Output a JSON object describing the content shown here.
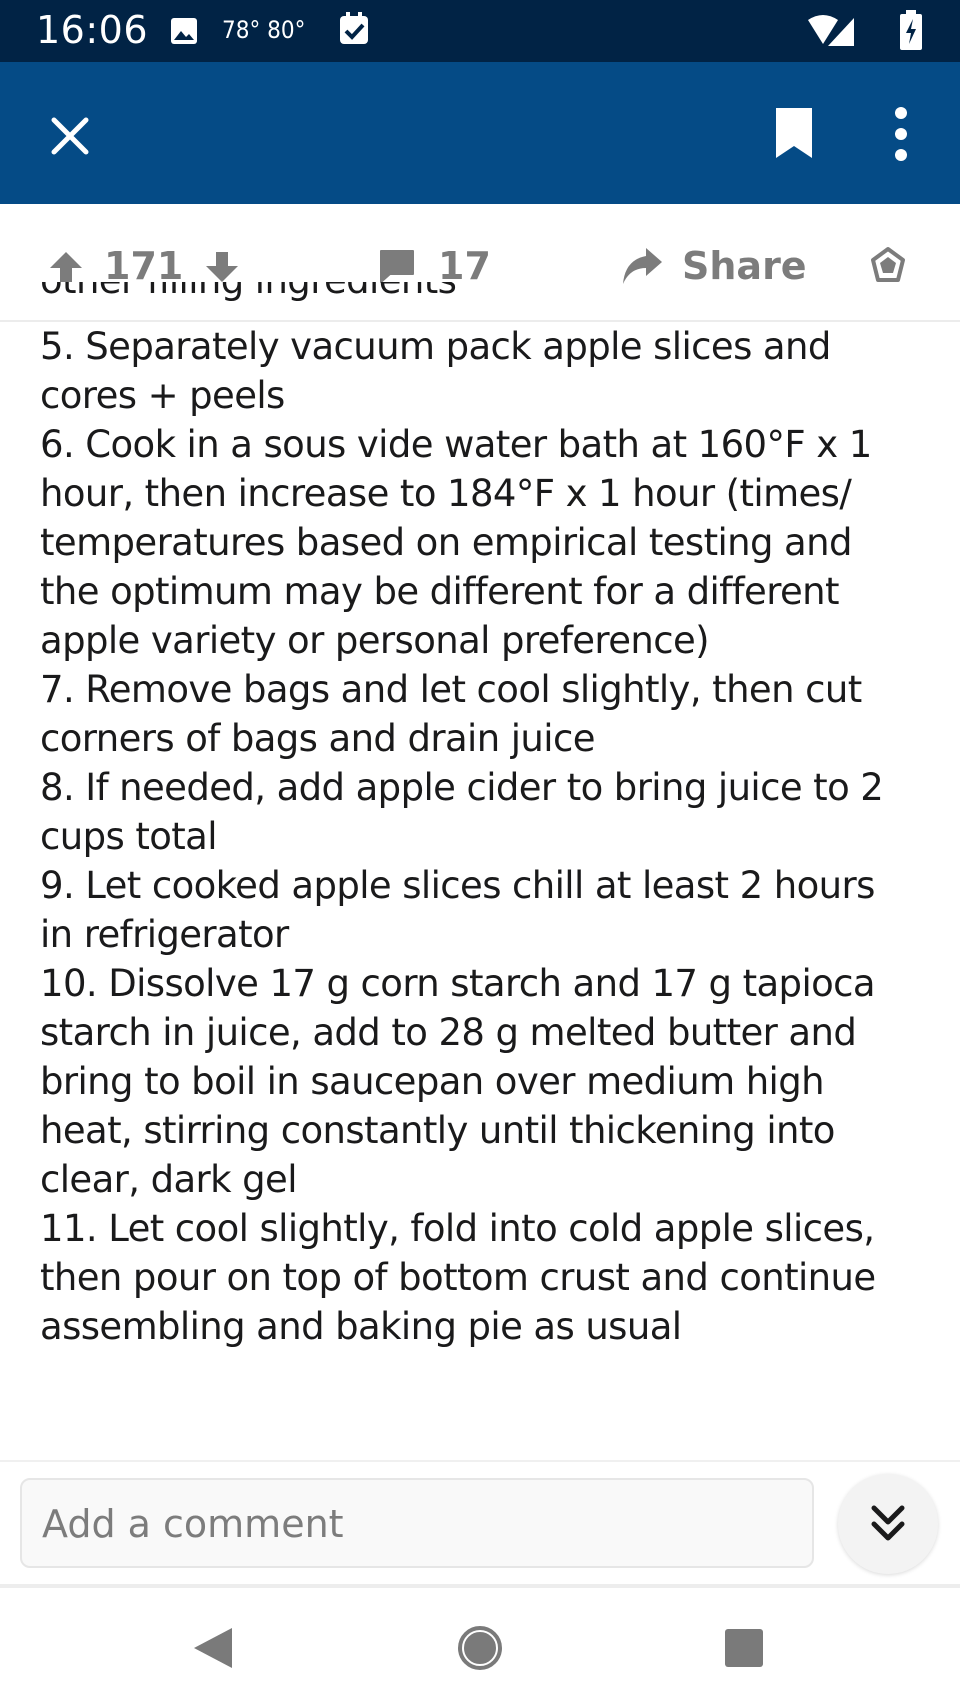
{
  "status_bar": {
    "time": "16:06",
    "temps": "78° 80°",
    "icons": [
      "image-icon",
      "check-icon",
      "wifi-icon",
      "signal-icon",
      "battery-charging-icon"
    ]
  },
  "app_bar": {
    "close_icon": "close-icon",
    "bookmark_icon": "bookmark-icon",
    "more_icon": "more-vert-icon",
    "background": "#054b86"
  },
  "vote_bar": {
    "score": "171",
    "comments": "17",
    "share_label": "Share"
  },
  "post": {
    "clipped_line": "other filling ingredients",
    "lines": [
      "5. Separately vacuum pack apple slices and",
      "cores + peels",
      "6. Cook in a sous vide water bath at 160°F x 1",
      "hour, then increase to 184°F x 1 hour (times/",
      "temperatures based on empirical testing and",
      "the optimum may be different for a different",
      "apple variety or personal preference)",
      "7. Remove bags and let cool slightly, then cut",
      "corners of bags and drain juice",
      "8. If needed, add apple cider to bring juice to 2",
      "cups total",
      "9. Let cooked apple slices chill at least 2 hours",
      "in refrigerator",
      "10. Dissolve 17 g corn starch and 17 g tapioca",
      "starch in juice, add to 28 g melted butter and",
      "bring to boil in saucepan over medium high",
      "heat, stirring constantly until thickening into",
      "clear, dark gel",
      "11. Let cool slightly, fold into cold apple slices,",
      "then pour on top of bottom crust and continue",
      "assembling and baking pie as usual"
    ]
  },
  "composer": {
    "placeholder": "Add a comment"
  },
  "nav_bar": {
    "icons": [
      "back-icon",
      "home-icon",
      "recents-icon"
    ]
  }
}
